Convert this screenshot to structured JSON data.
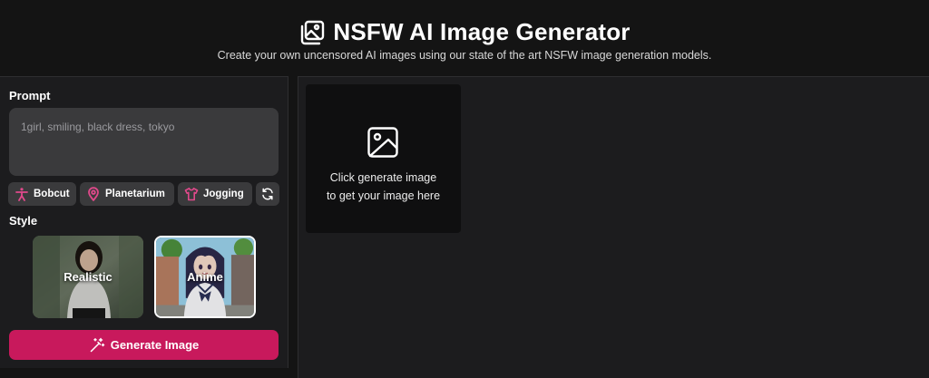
{
  "header": {
    "title": "NSFW AI Image Generator",
    "subtitle": "Create your own uncensored AI images using our state of the art NSFW image generation models.",
    "icon": "images-icon"
  },
  "prompt": {
    "label": "Prompt",
    "placeholder": "1girl, smiling, black dress, tokyo",
    "value": ""
  },
  "chips": [
    {
      "label": "Bobcut",
      "icon": "pose-icon"
    },
    {
      "label": "Planetarium",
      "icon": "location-pin-icon"
    },
    {
      "label": "Jogging",
      "icon": "shirt-icon"
    },
    {
      "label": "",
      "icon": "refresh-icon"
    }
  ],
  "style": {
    "label": "Style",
    "options": [
      {
        "label": "Realistic",
        "selected": false
      },
      {
        "label": "Anime",
        "selected": true
      }
    ]
  },
  "generate_button": {
    "label": "Generate Image",
    "icon": "magic-wand-icon"
  },
  "output": {
    "line1": "Click generate image",
    "line2": "to get your image here",
    "icon": "image-icon"
  },
  "colors": {
    "accent": "#c8195c",
    "chip_icon": "#e0498b",
    "background": "#141414",
    "panel": "#1c1c1e"
  }
}
